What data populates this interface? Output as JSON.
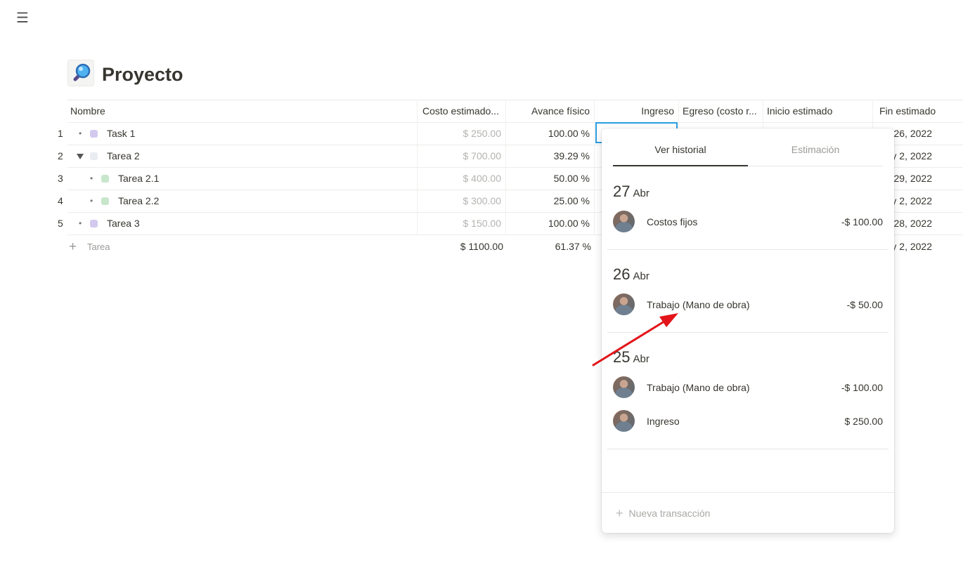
{
  "page": {
    "title": "Proyecto",
    "icon": "magnifier-icon"
  },
  "columns": [
    "Nombre",
    "Costo estimado...",
    "Avance físico",
    "Ingreso",
    "Egreso (costo r...",
    "Inicio estimado",
    "Fin estimado"
  ],
  "rows": [
    {
      "num": "1",
      "name": "Task 1",
      "cost": "$ 250.00",
      "progress": "100.00 %",
      "fin": "r 26, 2022",
      "chip": "#d3c9ee"
    },
    {
      "num": "2",
      "name": "Tarea 2",
      "cost": "$ 700.00",
      "progress": "39.29 %",
      "fin": "y 2, 2022",
      "chip": "#e9ecf0"
    },
    {
      "num": "3",
      "name": "Tarea 2.1",
      "cost": "$ 400.00",
      "progress": "50.00 %",
      "fin": "r 29, 2022",
      "chip": "#c8e6cc"
    },
    {
      "num": "4",
      "name": "Tarea 2.2",
      "cost": "$ 300.00",
      "progress": "25.00 %",
      "fin": "y 2, 2022",
      "chip": "#c8e6cc"
    },
    {
      "num": "5",
      "name": "Tarea 3",
      "cost": "$ 150.00",
      "progress": "100.00 %",
      "fin": "r 28, 2022",
      "chip": "#d3c9ee"
    }
  ],
  "summary": {
    "new_label": "Tarea",
    "cost_total": "$ 1100.00",
    "progress_total": "61.37 %",
    "fin": "y 2, 2022"
  },
  "popup": {
    "tabs": [
      "Ver historial",
      "Estimación"
    ],
    "groups": [
      {
        "day": "27",
        "month": "Abr",
        "items": [
          {
            "label": "Costos fijos",
            "amount": "-$ 100.00"
          }
        ]
      },
      {
        "day": "26",
        "month": "Abr",
        "items": [
          {
            "label": "Trabajo (Mano de obra)",
            "amount": "-$ 50.00"
          }
        ]
      },
      {
        "day": "25",
        "month": "Abr",
        "items": [
          {
            "label": "Trabajo (Mano de obra)",
            "amount": "-$ 100.00"
          },
          {
            "label": "Ingreso",
            "amount": "$ 250.00"
          }
        ]
      }
    ],
    "new_transaction": "Nueva transacción"
  }
}
